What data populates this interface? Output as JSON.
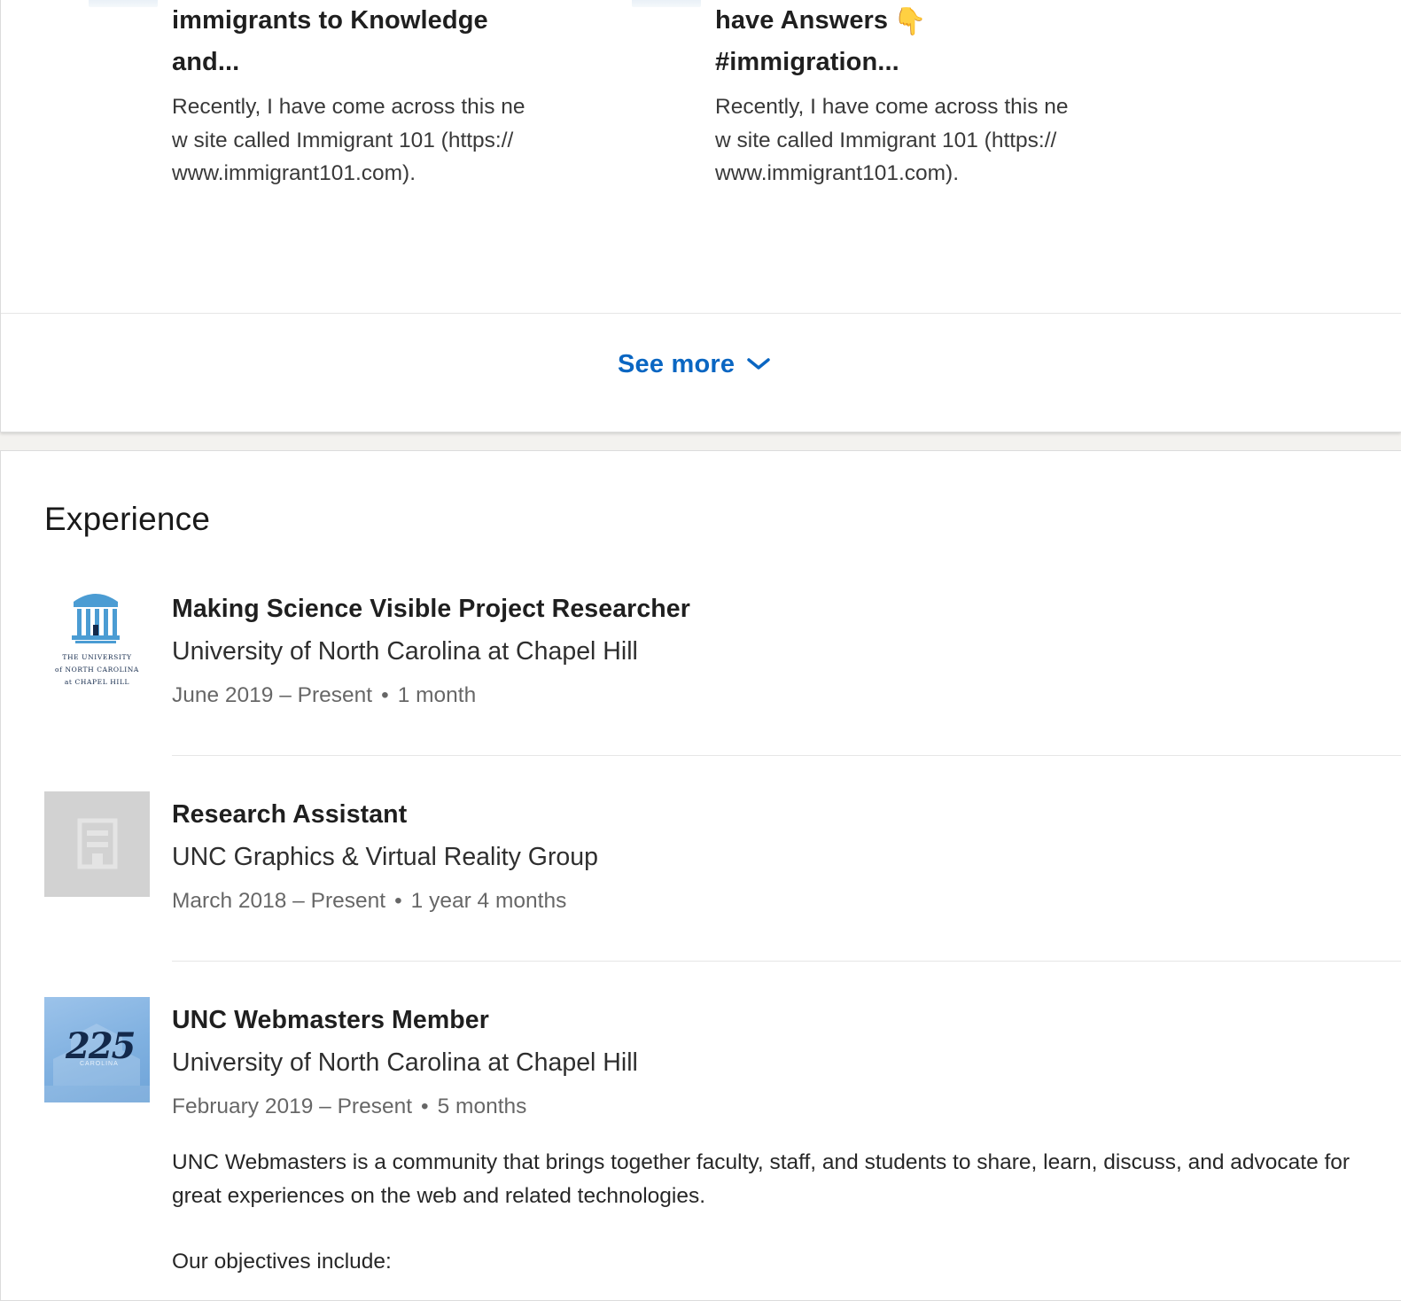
{
  "articles": [
    {
      "title_lines": [
        "immigrants to Knowledge",
        "and..."
      ],
      "body": "Recently, I have come across this new site called Immigrant 101 (https://www.immigrant101.com)."
    },
    {
      "title_lines": [
        "have Answers",
        "#immigration..."
      ],
      "title_icon": "backhand-pointing-down-icon",
      "body": "Recently, I have come across this new site called Immigrant 101 (https://www.immigrant101.com)."
    }
  ],
  "see_more": {
    "label": "See more",
    "icon": "chevron-down-icon",
    "color": "#0a66c2"
  },
  "experience": {
    "heading": "Experience",
    "entries": [
      {
        "title": "Making Science Visible Project Researcher",
        "company": "University of North Carolina at Chapel Hill",
        "dates": "June 2019 – Present",
        "duration": "1 month",
        "logo": "unc-old-well-logo",
        "logo_text": [
          "THE UNIVERSITY",
          "of NORTH CAROLINA",
          "at CHAPEL HILL"
        ]
      },
      {
        "title": "Research Assistant",
        "company": "UNC Graphics & Virtual Reality Group",
        "dates": "March 2018 – Present",
        "duration": "1 year 4 months",
        "logo": "company-building-placeholder-icon"
      },
      {
        "title": "UNC Webmasters Member",
        "company": "University of North Carolina at Chapel Hill",
        "dates": "February 2019 – Present",
        "duration": "5 months",
        "logo": "unc-225-logo",
        "logo_text": [
          "225",
          "CAROLINA"
        ],
        "description": "UNC Webmasters is a community that brings together faculty, staff, and students to share, learn, discuss, and advocate for great experiences on the web and related technologies.",
        "description_more": "Our objectives include:"
      }
    ]
  },
  "colors": {
    "unc_blue": "#4b9cd3",
    "navy": "#13294b"
  }
}
